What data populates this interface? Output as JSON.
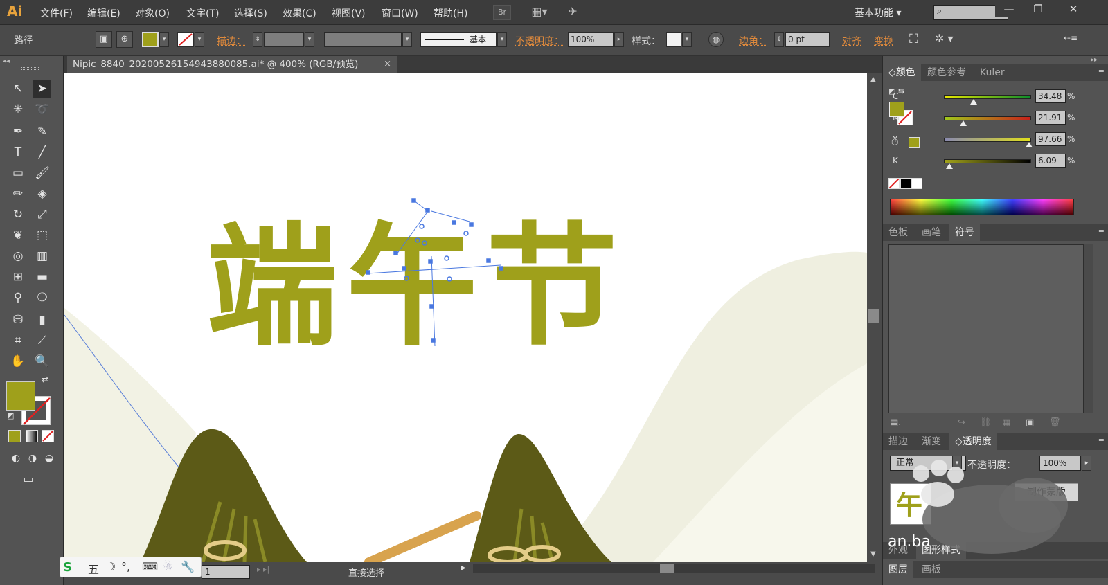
{
  "app": {
    "logo": "Ai"
  },
  "menu": [
    "文件(F)",
    "编辑(E)",
    "对象(O)",
    "文字(T)",
    "选择(S)",
    "效果(C)",
    "视图(V)",
    "窗口(W)",
    "帮助(H)"
  ],
  "menubar": {
    "bridge_label": "Br",
    "workspace": "基本功能"
  },
  "control": {
    "selection_label": "路径",
    "stroke_label": "描边：",
    "stroke_style": "基本",
    "opacity_label": "不透明度：",
    "opacity_value": "100%",
    "style_label": "样式：",
    "corner_label": "边角：",
    "corner_value": "0 pt",
    "align_label": "对齐",
    "transform_label": "变换"
  },
  "document": {
    "tab_title": "Nipic_8840_20200526154943880085.ai* @ 400% (RGB/预览)",
    "close": "×"
  },
  "artwork": {
    "title_text": "端午节",
    "accent_color": "#9fa01b",
    "mountain_color": "#5c5a17"
  },
  "status": {
    "zoom": "1",
    "mode": "直接选择"
  },
  "color_panel": {
    "tabs": [
      "颜色",
      "颜色参考",
      "Kuler"
    ],
    "channels": [
      {
        "name": "C",
        "value": "34.48",
        "knob": 0.34,
        "gradient": "linear-gradient(to right,#e8e800,#0b8c2b)"
      },
      {
        "name": "M",
        "value": "21.91",
        "knob": 0.22,
        "gradient": "linear-gradient(to right,#9fc81b,#c8201b)"
      },
      {
        "name": "Y",
        "value": "97.66",
        "knob": 0.98,
        "gradient": "linear-gradient(to right,#8a8ab0,#e0df1b)"
      },
      {
        "name": "K",
        "value": "6.09",
        "knob": 0.06,
        "gradient": "linear-gradient(to right,#a3a41b,#000000)"
      }
    ],
    "percent": "%",
    "fill_color": "#9fa01b"
  },
  "swatch_panel": {
    "tabs": [
      "色板",
      "画笔",
      "符号"
    ]
  },
  "transparency_panel": {
    "tabs": [
      "描边",
      "渐变",
      "透明度"
    ],
    "blend_mode": "正常",
    "opacity_label": "不透明度：",
    "opacity_value": "100%",
    "make_mask": "制作蒙版"
  },
  "appearance_panel": {
    "tabs": [
      "外观",
      "图形样式"
    ]
  },
  "layers_panel": {
    "tabs": [
      "图层",
      "画板"
    ]
  },
  "watermark": {
    "text": "an.ba"
  },
  "ime": {
    "items": [
      "五"
    ]
  }
}
